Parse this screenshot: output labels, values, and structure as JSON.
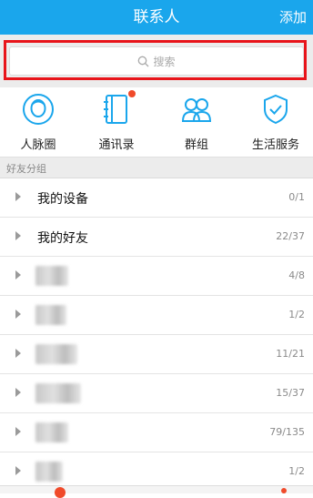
{
  "header": {
    "title": "联系人",
    "action": "添加"
  },
  "search": {
    "placeholder": "搜索"
  },
  "shortcuts": [
    {
      "label": "人脉圈",
      "icon": "face-circle-icon"
    },
    {
      "label": "通讯录",
      "icon": "address-book-icon",
      "badge": true
    },
    {
      "label": "群组",
      "icon": "group-people-icon"
    },
    {
      "label": "生活服务",
      "icon": "shield-check-icon"
    }
  ],
  "section": {
    "title": "好友分组"
  },
  "groups": [
    {
      "name": "我的设备",
      "count": "0/1"
    },
    {
      "name": "我的好友",
      "count": "22/37"
    },
    {
      "name": "",
      "count": "4/8"
    },
    {
      "name": "",
      "count": "1/2"
    },
    {
      "name": "",
      "count": "11/21"
    },
    {
      "name": "",
      "count": "15/37"
    },
    {
      "name": "",
      "count": "79/135"
    },
    {
      "name": "",
      "count": "1/2"
    }
  ],
  "colors": {
    "accent": "#1aa6ec",
    "highlight": "#e8141a",
    "badge": "#f04a2a"
  }
}
